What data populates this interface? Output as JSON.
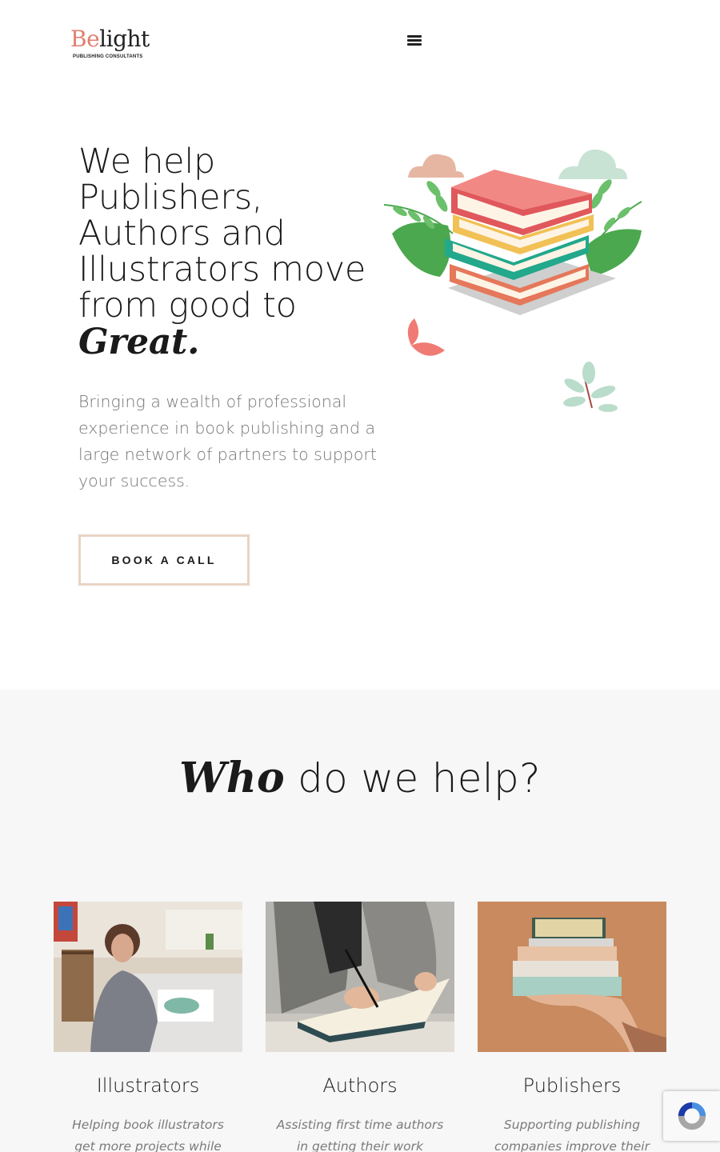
{
  "header": {
    "logo_prefix": "Be",
    "logo_suffix": "light",
    "logo_tagline": "PUBLISHING CONSULTANTS",
    "menu_icon": "hamburger-menu-icon"
  },
  "hero": {
    "title_lines": [
      "We help",
      "Publishers,",
      "Authors and",
      "Illustrators move",
      "from good to"
    ],
    "title_emphasis": "Great.",
    "subtitle": "Bringing a wealth of professional experience in book publishing and a large network of partners to support your success.",
    "cta_label": "BOOK A CALL",
    "illustration": "stack-of-books-illustration"
  },
  "who_section": {
    "title_emphasis": "Who",
    "title_rest": " do we help?",
    "cards": [
      {
        "title": "Illustrators",
        "description": "Helping book illustrators get more projects while keeping",
        "photo": "illustrator-painting-photo"
      },
      {
        "title": "Authors",
        "description": "Assisting first time authors in getting their work published",
        "photo": "author-writing-photo"
      },
      {
        "title": "Publishers",
        "description": "Supporting publishing companies improve their book",
        "photo": "hand-holding-books-photo"
      }
    ]
  },
  "recaptcha": {
    "icon": "recaptcha-icon"
  },
  "colors": {
    "accent_logo": "#e07f6f",
    "cta_border": "#e8d3c4",
    "section_bg": "#f7f7f7",
    "body_text": "#757575"
  }
}
